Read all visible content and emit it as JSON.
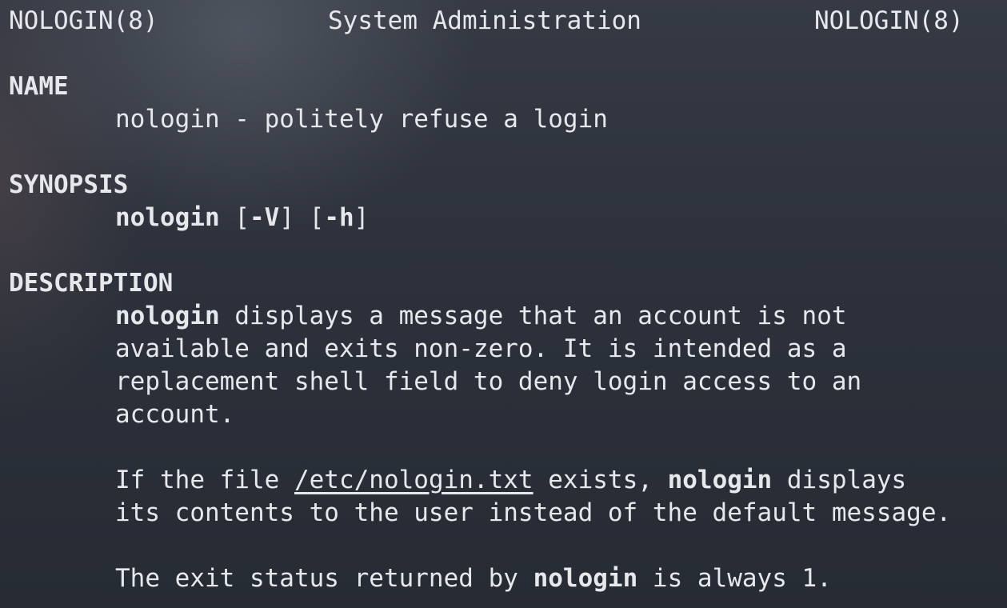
{
  "header": {
    "left": "NOLOGIN(8)",
    "center": "System Administration",
    "right": "NOLOGIN(8)"
  },
  "sections": {
    "name": {
      "heading": "NAME",
      "text": "nologin - politely refuse a login"
    },
    "synopsis": {
      "heading": "SYNOPSIS",
      "command": "nologin",
      "opt_open_1": " [",
      "opt_v": "-V",
      "opt_mid": "] [",
      "opt_h": "-h",
      "opt_close": "]"
    },
    "description": {
      "heading": "DESCRIPTION",
      "p1_cmd": "nologin",
      "p1_l1_rest": " displays a message that an account is not",
      "p1_l2": "available and exits non-zero. It is intended as a",
      "p1_l3": "replacement shell field to deny login access to an",
      "p1_l4": "account.",
      "p2_l1_a": "If the file ",
      "p2_file": "/etc/nologin.txt",
      "p2_l1_b": " exists, ",
      "p2_cmd": "nologin",
      "p2_l1_c": " displays",
      "p2_l2": "its contents to the user instead of the default message.",
      "p3_a": "The exit status returned by ",
      "p3_cmd": "nologin",
      "p3_b": " is always 1."
    }
  }
}
